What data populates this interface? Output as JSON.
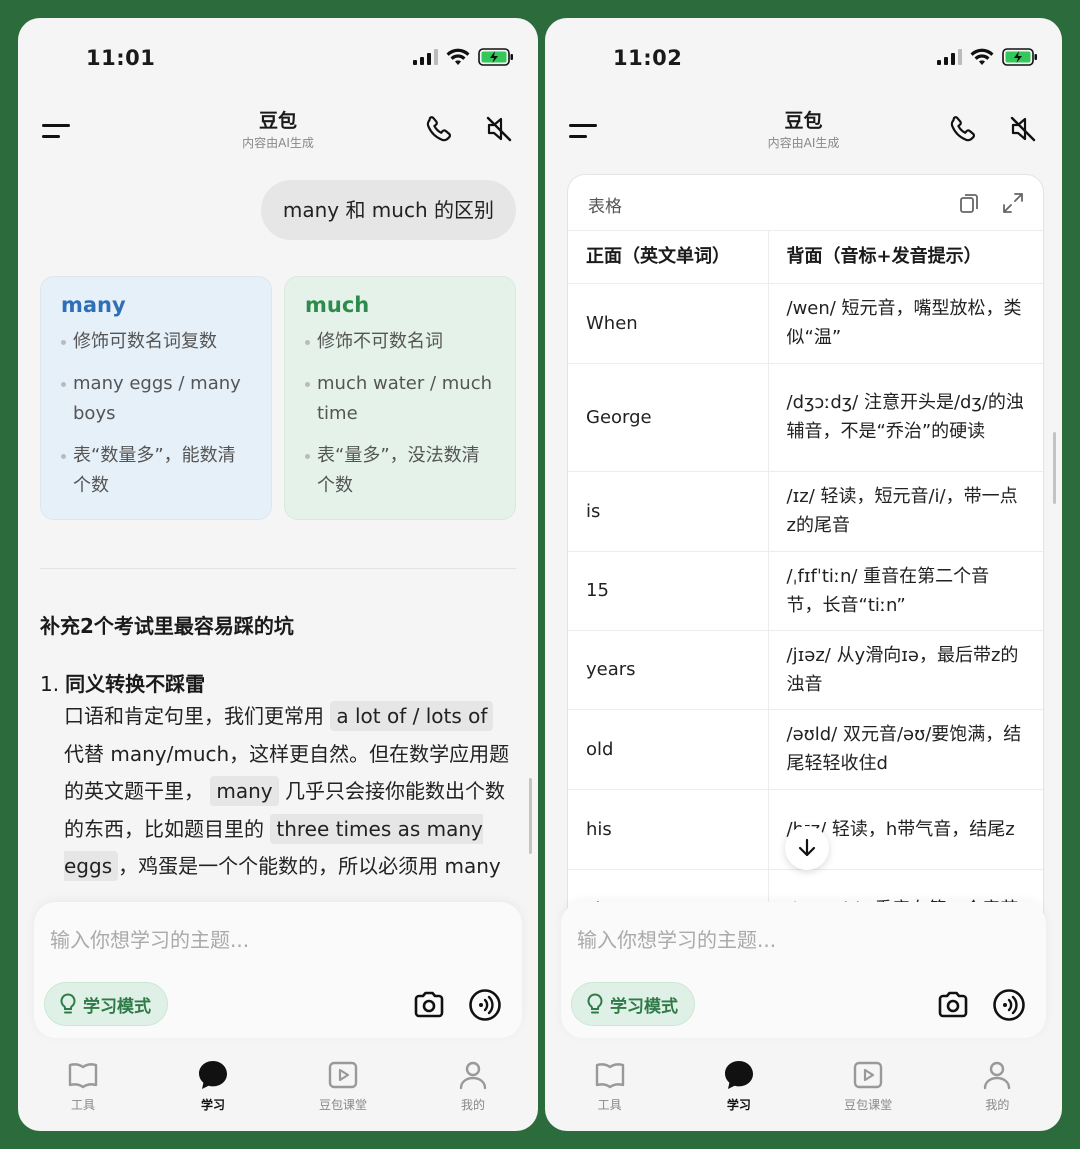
{
  "left": {
    "status_time": "11:01",
    "app_title": "豆包",
    "app_subtitle": "内容由AI生成",
    "user_message": "many 和 much 的区别",
    "cards": [
      {
        "title": "many",
        "items": [
          "修饰可数名词复数",
          "many eggs / many boys",
          "表“数量多”，能数清个数"
        ]
      },
      {
        "title": "much",
        "items": [
          "修饰不可数名词",
          "much water / much time",
          "表“量多”，没法数清个数"
        ]
      }
    ],
    "section_title": "补充2个考试里最容易踩的坑",
    "item_number": "1.",
    "item_title": "同义转换不踩雷",
    "item_body": {
      "t1": "口语和肯定句里，我们更常用",
      "c1": "a lot of / lots of",
      "t2": "代替 many/much，这样更自然。但在数学应用题的英文题干里，",
      "c2": "many",
      "t3": "几乎只会接你能数出个数的东西，比如题目里的",
      "c3": "three times as many eggs",
      "t4": "，鸡蛋是一个个能数的，所以必须用 many"
    },
    "input_placeholder": "输入你想学习的主题...",
    "mode_chip": "学习模式"
  },
  "right": {
    "status_time": "11:02",
    "app_title": "豆包",
    "app_subtitle": "内容由AI生成",
    "table_label": "表格",
    "table_headers": [
      "正面（英文单词）",
      "背面（音标+发音提示）"
    ],
    "table_rows": [
      [
        "When",
        "/wen/ 短元音，嘴型放松，类似“温”"
      ],
      [
        "George",
        "/dʒɔːdʒ/ 注意开头是/dʒ/的浊辅音，不是“乔治”的硬读"
      ],
      [
        "is",
        "/ɪz/ 轻读，短元音/i/，带一点z的尾音"
      ],
      [
        "15",
        "/ˌfɪfˈtiːn/ 重音在第二个音节，长音“tiːn”"
      ],
      [
        "years",
        "/jɪəz/ 从y滑向ɪə，最后带z的浊音"
      ],
      [
        "old",
        "/əʊld/ 双元音/əʊ/要饱满，结尾轻轻收住d"
      ],
      [
        "his",
        "/hɪz/ 轻读，h带气音，结尾z"
      ],
      [
        "sister",
        "/ˈsɪstə(r)/ 重音在第一个音节"
      ]
    ],
    "input_placeholder": "输入你想学习的主题...",
    "mode_chip": "学习模式"
  },
  "tabs": [
    "工具",
    "学习",
    "豆包课堂",
    "我的"
  ],
  "colors": {
    "frame": "#2b6b3c",
    "accent_green": "#2f7a48",
    "many_blue": "#2f6fb8",
    "much_green": "#2f8a4d"
  }
}
